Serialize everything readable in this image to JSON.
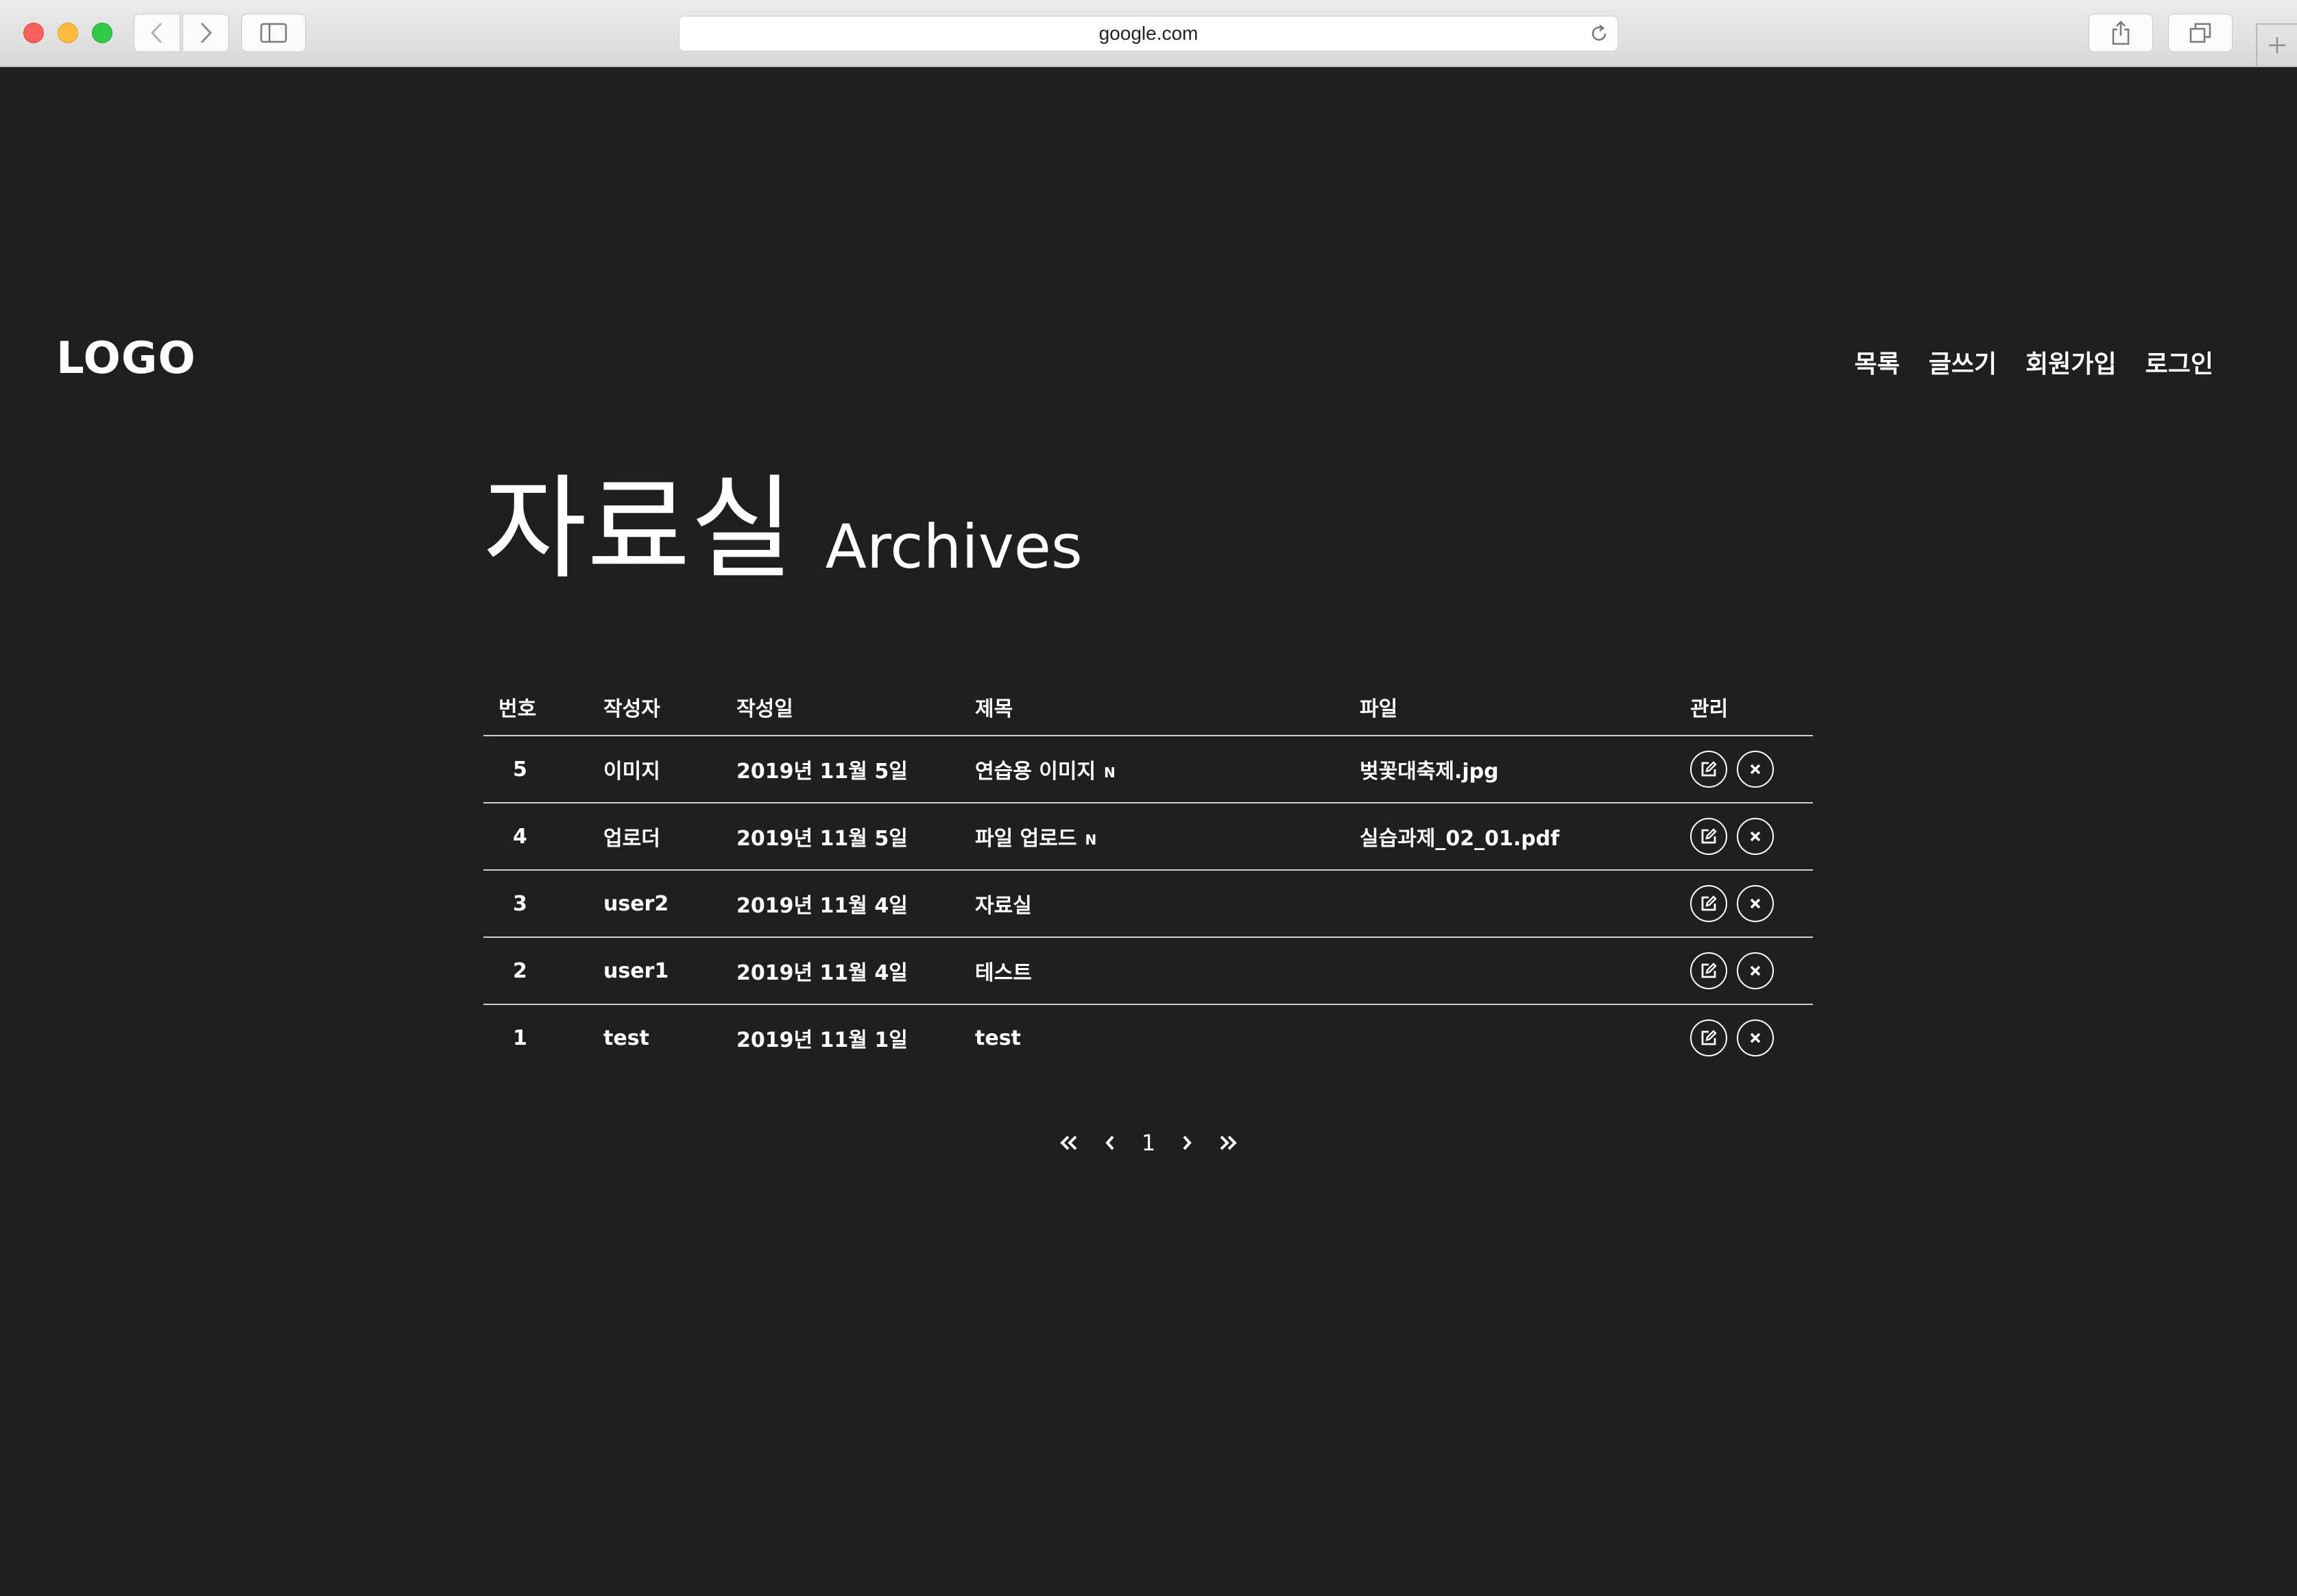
{
  "browser": {
    "url": "google.com"
  },
  "header": {
    "logo": "LOGO",
    "nav": [
      "목록",
      "글쓰기",
      "회원가입",
      "로그인"
    ]
  },
  "page": {
    "title_ko": "자료실",
    "title_en": "Archives"
  },
  "table": {
    "columns": [
      "번호",
      "작성자",
      "작성일",
      "제목",
      "파일",
      "관리"
    ],
    "rows": [
      {
        "no": "5",
        "author": "이미지",
        "date": "2019년 11월 5일",
        "title": "연습용 이미지",
        "new": "N",
        "file": "벚꽃대축제.jpg"
      },
      {
        "no": "4",
        "author": "업로더",
        "date": "2019년 11월 5일",
        "title": "파일 업로드",
        "new": "N",
        "file": "실습과제_02_01.pdf"
      },
      {
        "no": "3",
        "author": "user2",
        "date": "2019년 11월 4일",
        "title": "자료실",
        "new": "",
        "file": ""
      },
      {
        "no": "2",
        "author": "user1",
        "date": "2019년 11월 4일",
        "title": "테스트",
        "new": "",
        "file": ""
      },
      {
        "no": "1",
        "author": "test",
        "date": "2019년 11월 1일",
        "title": "test",
        "new": "",
        "file": ""
      }
    ]
  },
  "pagination": {
    "current": "1",
    "icons": [
      "first-page-icon",
      "prev-page-icon",
      "next-page-icon",
      "last-page-icon"
    ]
  },
  "colors": {
    "background": "#1f1f1f",
    "text": "#ffffff",
    "divider": "#cfcfcf"
  }
}
